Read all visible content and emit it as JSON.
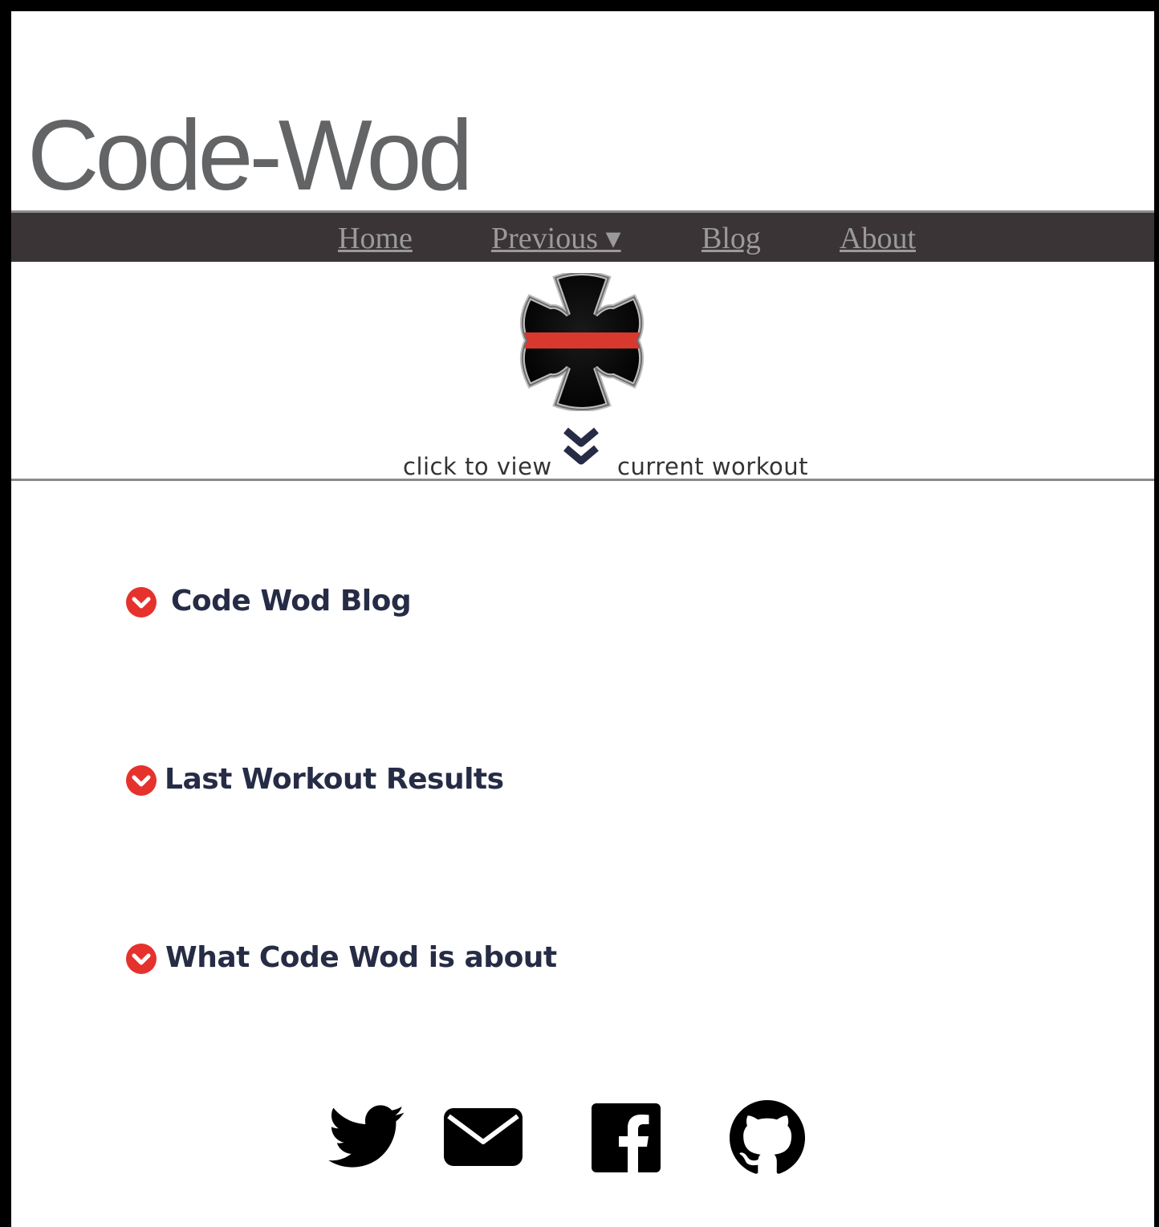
{
  "site": {
    "title": "Code-Wod"
  },
  "nav": {
    "items": [
      {
        "label": "Home"
      },
      {
        "label": "Previous ▾"
      },
      {
        "label": "Blog"
      },
      {
        "label": "About"
      }
    ]
  },
  "logo": {
    "icon": "maltese-cross-thin-red-line-icon"
  },
  "cta": {
    "before": "click to view",
    "after": "current workout",
    "icon": "double-chevron-down-icon"
  },
  "sections": [
    {
      "title": "Code Wod Blog",
      "icon": "chevron-circle-down-icon"
    },
    {
      "title": "Last Workout Results",
      "icon": "chevron-circle-down-icon"
    },
    {
      "title": "What Code Wod is about",
      "icon": "chevron-circle-down-icon"
    }
  ],
  "social": [
    {
      "name": "twitter-icon"
    },
    {
      "name": "envelope-icon"
    },
    {
      "name": "facebook-icon"
    },
    {
      "name": "github-icon"
    }
  ],
  "colors": {
    "navbar": "#3b3436",
    "accent": "#e5322d",
    "heading": "#262c45",
    "title": "#636466"
  }
}
